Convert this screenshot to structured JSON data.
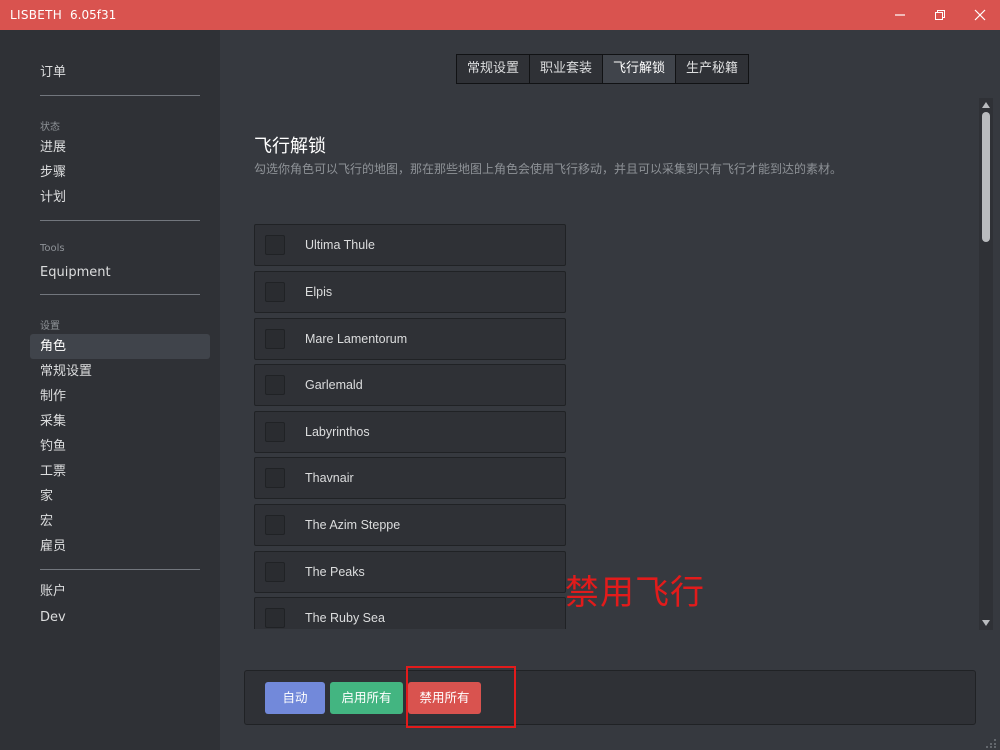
{
  "titlebar": {
    "app_name": "LISBETH",
    "version": "6.05f31",
    "accent": "#d9534f"
  },
  "sidebar": {
    "order": "订单",
    "sections": [
      {
        "label": "状态",
        "items": [
          "进展",
          "步骤",
          "计划"
        ]
      },
      {
        "label": "Tools",
        "items": [
          "Equipment"
        ]
      },
      {
        "label": "设置",
        "items": [
          "角色",
          "常规设置",
          "制作",
          "采集",
          "钓鱼",
          "工票",
          "家",
          "宏",
          "雇员"
        ]
      }
    ],
    "bottom": [
      "账户",
      "Dev"
    ],
    "active_item": "角色"
  },
  "tabs": [
    {
      "label": "常规设置",
      "active": false
    },
    {
      "label": "职业套装",
      "active": false
    },
    {
      "label": "飞行解锁",
      "active": true
    },
    {
      "label": "生产秘籍",
      "active": false
    }
  ],
  "section": {
    "title": "飞行解锁",
    "description": "勾选你角色可以飞行的地图，那在那些地图上角色会使用飞行移动，并且可以采集到只有飞行才能到达的素材。"
  },
  "maps": [
    {
      "name": "Ultima Thule",
      "checked": false
    },
    {
      "name": "Elpis",
      "checked": false
    },
    {
      "name": "Mare Lamentorum",
      "checked": false
    },
    {
      "name": "Garlemald",
      "checked": false
    },
    {
      "name": "Labyrinthos",
      "checked": false
    },
    {
      "name": "Thavnair",
      "checked": false
    },
    {
      "name": "The Azim Steppe",
      "checked": false
    },
    {
      "name": "The Peaks",
      "checked": false
    },
    {
      "name": "The Ruby Sea",
      "checked": false
    }
  ],
  "annotation": "禁用飞行",
  "actions": {
    "auto": "自动",
    "enable_all": "启用所有",
    "disable_all": "禁用所有"
  },
  "colors": {
    "auto": "#7289da",
    "enable": "#43b581",
    "disable": "#d9534f",
    "annotation": "#e21b1b"
  }
}
